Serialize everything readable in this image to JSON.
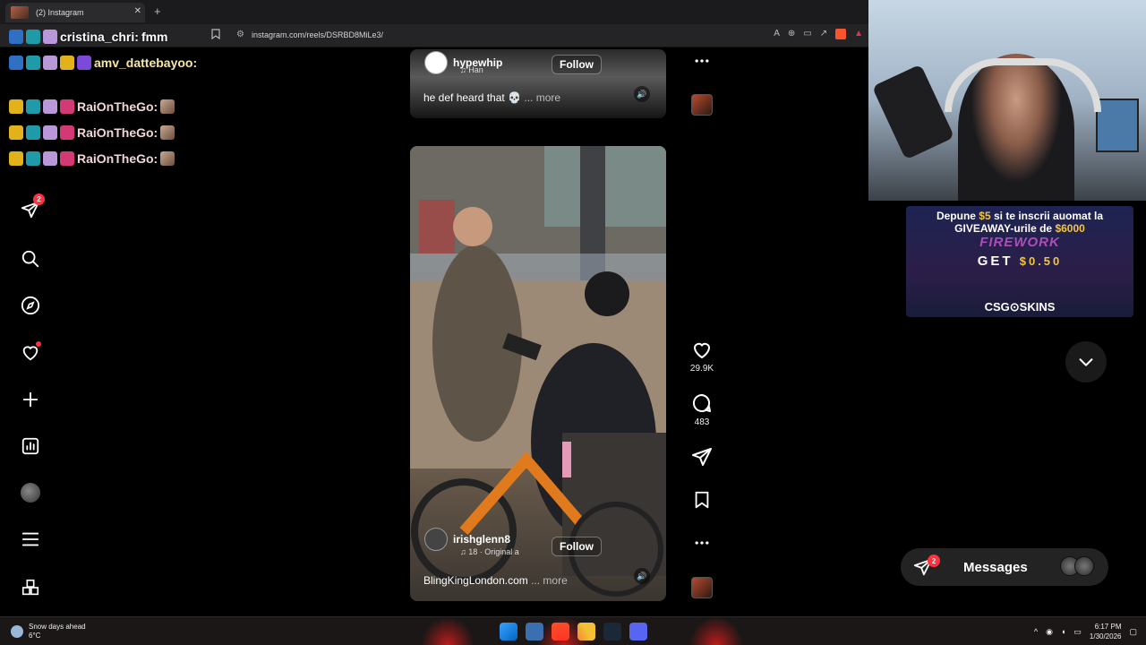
{
  "browser": {
    "tab_title": "(2) Instagram",
    "tab_close": "✕",
    "new_tab": "+",
    "url": "instagram.com/reels/DSRBD8MiLe3/"
  },
  "chat": [
    {
      "user": "cristina_chri:",
      "message": "fmm"
    },
    {
      "user": "amv_dattebayoo:",
      "message": ""
    },
    {
      "user": "RaiOnTheGo:",
      "message": ""
    },
    {
      "user": "RaiOnTheGo:",
      "message": ""
    },
    {
      "user": "RaiOnTheGo:",
      "message": ""
    }
  ],
  "nav": {
    "messages_badge": "2",
    "icons": [
      "direct-icon",
      "search-icon",
      "explore-icon",
      "heart-icon",
      "create-icon",
      "insights-icon",
      "profile-avatar",
      "menu-icon",
      "apps-icon"
    ]
  },
  "reel_top": {
    "username": "hypewhip",
    "audio": "Han",
    "follow": "Follow",
    "caption": "he def heard that 💀",
    "more": "... more"
  },
  "reel_main": {
    "username": "irishglenn8",
    "audio": "18 · Original a",
    "follow": "Follow",
    "caption": "BlingKingLondon.com",
    "more": "... more"
  },
  "actions": {
    "likes": "29.9K",
    "comments": "483"
  },
  "ad": {
    "line1_pre": "Depune ",
    "line1_amount": "$5",
    "line1_post": " si te inscrii auomat la",
    "line2_pre": "GIVEAWAY-urile de ",
    "line2_amount": "$6000",
    "event": "FIREWORK",
    "get": "GET",
    "get_amount": "$0.50",
    "brand": "CSG⊙SKINS"
  },
  "messages": {
    "label": "Messages",
    "badge": "2"
  },
  "taskbar": {
    "weather_title": "Snow days ahead",
    "weather_temp": "6°C",
    "time": "6:17 PM",
    "date": "1/30/2026"
  },
  "colors": {
    "instagram_red": "#ff3040",
    "ad_gold": "#f3c63c"
  }
}
